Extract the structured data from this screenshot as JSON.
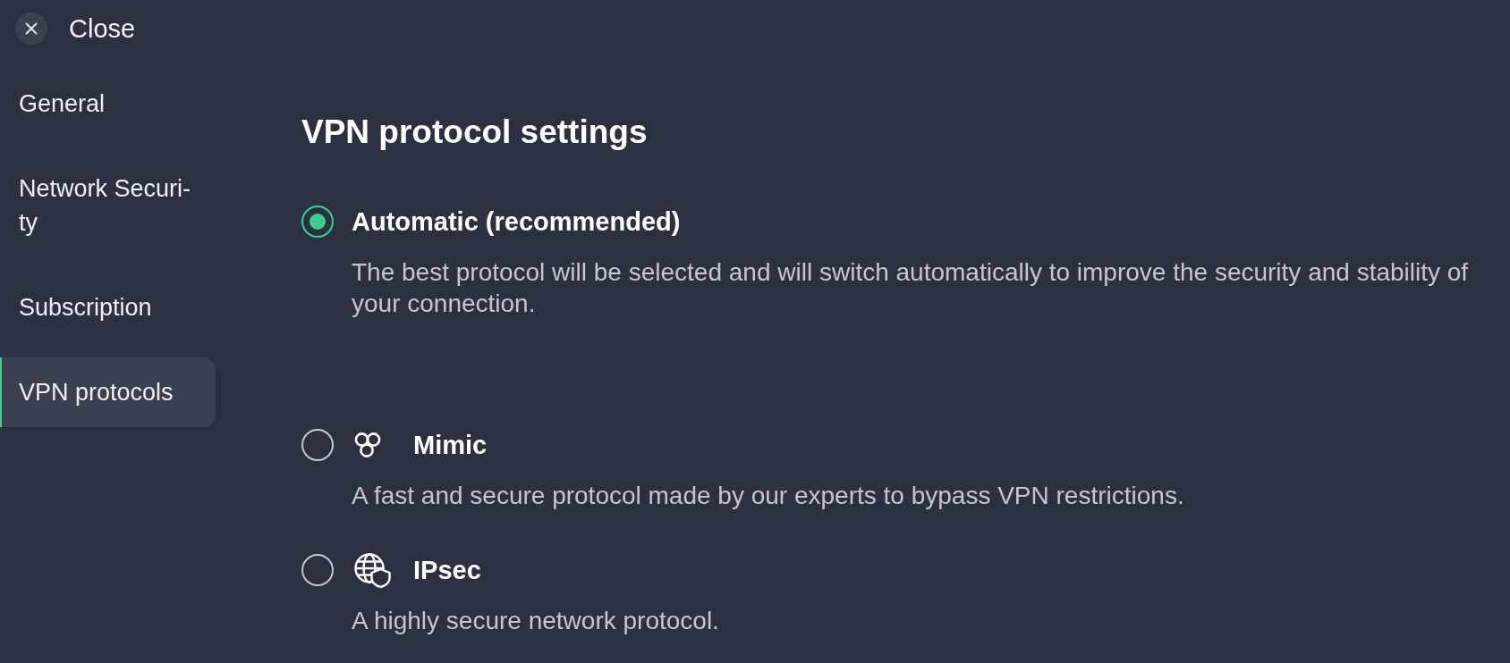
{
  "close_button": {
    "label": "Close"
  },
  "sidebar": {
    "items": [
      {
        "label": "General",
        "selected": false
      },
      {
        "label": "Network Securi-ty",
        "selected": false
      },
      {
        "label": "Subscription",
        "selected": false
      },
      {
        "label": "VPN protocols",
        "selected": true
      }
    ]
  },
  "main": {
    "title": "VPN protocol settings",
    "options": [
      {
        "kind": "automatic",
        "title": "Automatic (recommended)",
        "description": "The best protocol will be selected and will switch automatically to improve the security and stability of your connection.",
        "selected": true
      },
      {
        "kind": "mimic",
        "title": "Mimic",
        "description": "A fast and secure protocol made by our experts to bypass VPN restrictions.",
        "selected": false
      },
      {
        "kind": "ipsec",
        "title": "IPsec",
        "description": "A highly secure network protocol.",
        "selected": false
      }
    ]
  }
}
